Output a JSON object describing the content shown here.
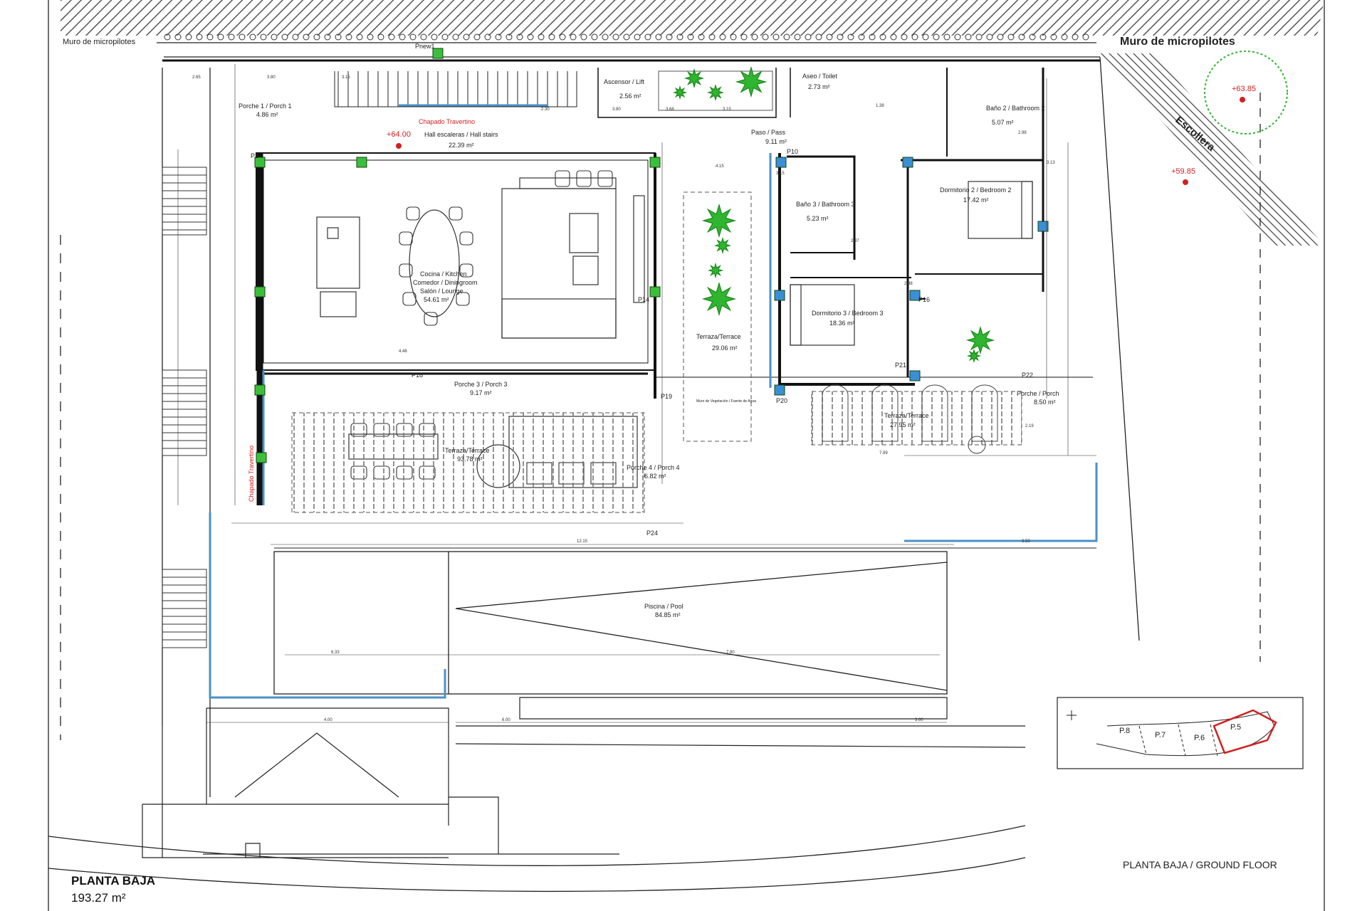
{
  "top_labels": {
    "retaining_wall_left": "Muro de micropilotes",
    "retaining_wall_right": "Muro de micropilotes",
    "breakwater": "Escollera",
    "pilar_new": "Pnew1"
  },
  "levels": [
    {
      "id": "lvl-6400",
      "text": "+64.00"
    },
    {
      "id": "lvl-6385",
      "text": "+63.85"
    },
    {
      "id": "lvl-5985",
      "text": "+59.85"
    }
  ],
  "rooms": {
    "porch1": {
      "name": "Porche 1 / Porch 1",
      "area": "4.86 m²"
    },
    "hall": {
      "name": "Hall escaleras / Hall stairs",
      "area": "22.39 m²"
    },
    "travertine_top": "Chapado Travertino",
    "lift": {
      "name": "Ascensor / Lift",
      "area": "2.56 m²"
    },
    "toilet": {
      "name": "Aseo / Toilet",
      "area": "2.73 m²"
    },
    "bath2": {
      "name": "Baño 2 / Bathroom 2",
      "area": "5.07 m²"
    },
    "passage": {
      "name": "Paso / Pass",
      "area": "9.11 m²"
    },
    "bed2": {
      "name": "Dormitorio 2 / Bedroom 2",
      "area": "17.42 m²"
    },
    "bath3": {
      "name": "Baño 3 / Bathroom 3",
      "area": "5.23 m²"
    },
    "kitchen": {
      "name": "Cocina / Kitchen",
      "name2": "Comedor / Diningroom",
      "name3": "Salón / Lounge",
      "area": "54.61 m²"
    },
    "bed3": {
      "name": "Dormitorio 3 / Bedroom 3",
      "area": "18.36 m²"
    },
    "terrace_mid": {
      "name": "Terraza/Terrace",
      "area": "29.06 m²",
      "note": "Muro de Vegetación / Fuente de Agua"
    },
    "porch3": {
      "name": "Porche 3 / Porch 3",
      "area": "9.17 m²"
    },
    "terrace_right": {
      "name": "Terraza/Terrace",
      "area": "27.95 m²"
    },
    "porch_right": {
      "name": "Porche / Porch",
      "area": "8.50 m²"
    },
    "terrace_left": {
      "name": "Terraza/Terrace",
      "area": "93.78 m²"
    },
    "porch4": {
      "name": "Porche 4 / Porch 4",
      "area": "6.82 m²"
    },
    "travertine_side": "Chapado Travertino",
    "pool": {
      "name": "Piscina / Pool",
      "area": "84.85 m²"
    }
  },
  "pillars": [
    "P1",
    "P14",
    "P16",
    "P18",
    "P19",
    "P20",
    "P21",
    "P22",
    "P24",
    "P10"
  ],
  "dimensions": [
    "2.65",
    "3.80",
    "3.15",
    "2.30",
    "3.80",
    "3.68",
    "3.15",
    "1.38",
    "6.33",
    "7.80",
    "12.15",
    "4.00",
    "6.00",
    "3.60",
    "3.50",
    "7.99",
    "2.98",
    "3.13",
    "2.48",
    "2.87",
    "3.15",
    "4.15",
    "4.48",
    "2.19"
  ],
  "keymap": {
    "plots": [
      "P.8",
      "P.7",
      "P.6",
      "P.5"
    ]
  },
  "footer": {
    "title_left": "PLANTA BAJA",
    "area_left": "193.27 m²",
    "title_right": "PLANTA BAJA / GROUND FLOOR"
  }
}
